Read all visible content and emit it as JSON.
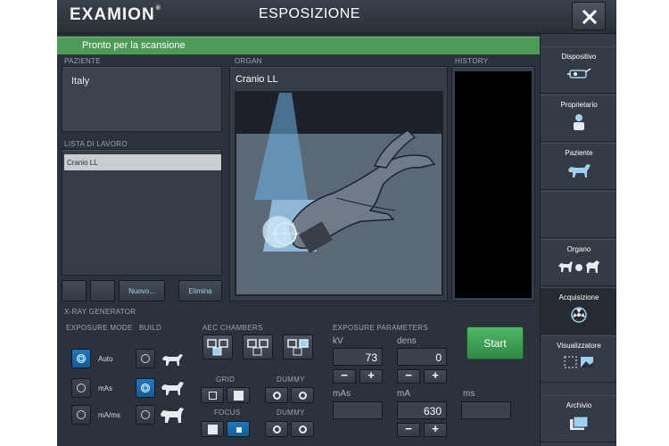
{
  "header": {
    "logo": "EXAMION",
    "logo_mark": "®",
    "title": "ESPOSIZIONE",
    "close_icon": "close-icon"
  },
  "status": {
    "text": "Pronto per la scansione",
    "color": "#4e9a59"
  },
  "patient": {
    "label": "PAZIENTE",
    "value": "Italy"
  },
  "worklist": {
    "label": "LISTA DI LAVORO",
    "items": [
      "Cranio LL"
    ],
    "buttons": {
      "new": "Nuovo...",
      "delete": "Elimina"
    }
  },
  "organ": {
    "label": "ORGAN",
    "name": "Cranio LL"
  },
  "history": {
    "label": "HISTORY"
  },
  "sidebar": {
    "items": [
      {
        "label": "Dispositivo",
        "icon": "device-icon"
      },
      {
        "label": "Proprietario",
        "icon": "owner-icon"
      },
      {
        "label": "Paziente",
        "icon": "dog-icon"
      },
      {
        "label": "",
        "icon": ""
      },
      {
        "label": "Organo",
        "icon": "animals-icon"
      },
      {
        "label": "Acquisizione",
        "icon": "radiation-icon"
      },
      {
        "label": "Visualizzatore",
        "icon": "viewer-icon"
      },
      {
        "label": "Archivio",
        "icon": "archive-icon"
      }
    ],
    "active": "Acquisizione"
  },
  "generator": {
    "label": "X-RAY GENERATOR",
    "exposure_mode": {
      "label": "EXPOSURE MODE",
      "options": [
        "Auto",
        "mAs",
        "mA/ms"
      ],
      "selected": "Auto"
    },
    "build": {
      "label": "BUILD",
      "selected_index": 1
    },
    "aec": {
      "label": "AEC CHAMBERS"
    },
    "grid": {
      "label": "GRID"
    },
    "focus": {
      "label": "FOCUS"
    },
    "dummy1": {
      "label": "DUMMY"
    },
    "dummy2": {
      "label": "DUMMY"
    },
    "parameters": {
      "label": "EXPOSURE PARAMETERS",
      "kv": {
        "label": "kV",
        "value": "73"
      },
      "dens": {
        "label": "dens",
        "value": "0"
      },
      "mas": {
        "label": "mAs",
        "value": ""
      },
      "ma": {
        "label": "mA",
        "value": "630"
      },
      "ms": {
        "label": "ms",
        "value": ""
      },
      "minus": "−",
      "plus": "+"
    },
    "start": "Start"
  }
}
